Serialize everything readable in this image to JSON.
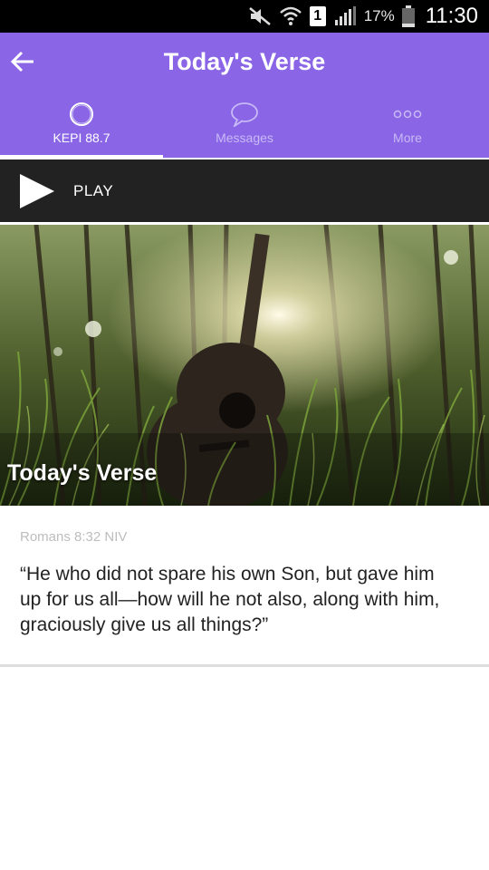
{
  "status_bar": {
    "battery": "17%",
    "time": "11:30",
    "sim_slot": "1",
    "icons": [
      "mute-icon",
      "wifi-icon",
      "sim-icon",
      "signal-icon",
      "battery-icon"
    ]
  },
  "app_bar": {
    "title": "Today's Verse",
    "back_icon": "arrow-left-icon",
    "color": "#8a66e6"
  },
  "tabs": [
    {
      "label": "KEPI 88.7",
      "icon": "radio-ring-icon",
      "active": true
    },
    {
      "label": "Messages",
      "icon": "chat-bubble-icon",
      "active": false
    },
    {
      "label": "More",
      "icon": "more-dots-icon",
      "active": false
    }
  ],
  "player": {
    "play_label": "PLAY",
    "icon": "play-icon"
  },
  "hero": {
    "title": "Today's Verse",
    "image": "guitar-in-tall-grass-photo"
  },
  "verse": {
    "reference": "Romans 8:32 NIV",
    "text": "“He who did not spare his own Son, but gave him up for us all—how will he not also, along with him, graciously give us all things?”"
  }
}
